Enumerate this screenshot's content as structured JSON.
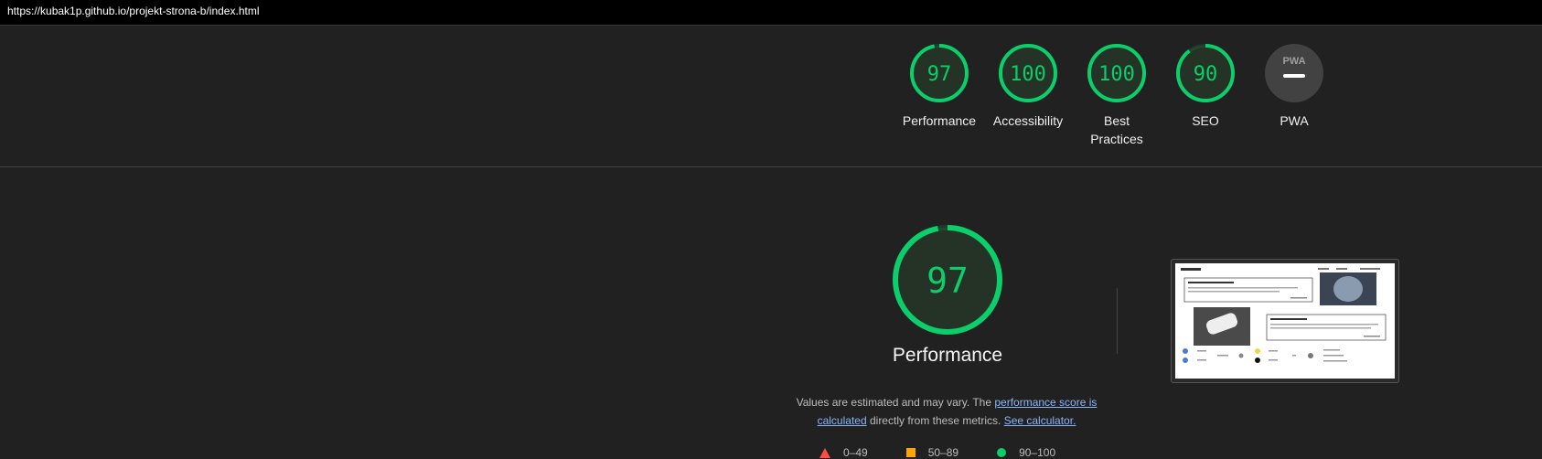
{
  "url": "https://kubak1p.github.io/projekt-strona-b/index.html",
  "colors": {
    "pass": "#0cce6b",
    "average": "#ffa400",
    "fail": "#ff4e42",
    "pwa_bg": "#424242"
  },
  "summary": [
    {
      "label": "Performance",
      "score": "97",
      "fraction": 0.97
    },
    {
      "label": "Accessibility",
      "score": "100",
      "fraction": 1.0
    },
    {
      "label": "Best Practices",
      "score": "100",
      "fraction": 1.0
    },
    {
      "label": "SEO",
      "score": "90",
      "fraction": 0.9
    },
    {
      "label": "PWA",
      "score": "",
      "fraction": 0,
      "badge": "PWA"
    }
  ],
  "performance": {
    "score": "97",
    "fraction": 0.97,
    "title": "Performance",
    "note_before": "Values are estimated and may vary. The ",
    "link_score": "performance score is calculated",
    "note_middle": " directly from these metrics. ",
    "link_calc": "See calculator.",
    "legend": [
      {
        "label": "0–49",
        "icon": "triangle-icon"
      },
      {
        "label": "50–89",
        "icon": "square-icon"
      },
      {
        "label": "90–100",
        "icon": "circle-icon"
      }
    ]
  },
  "thumbnail": {
    "icon": "page-screenshot-thumbnail"
  }
}
